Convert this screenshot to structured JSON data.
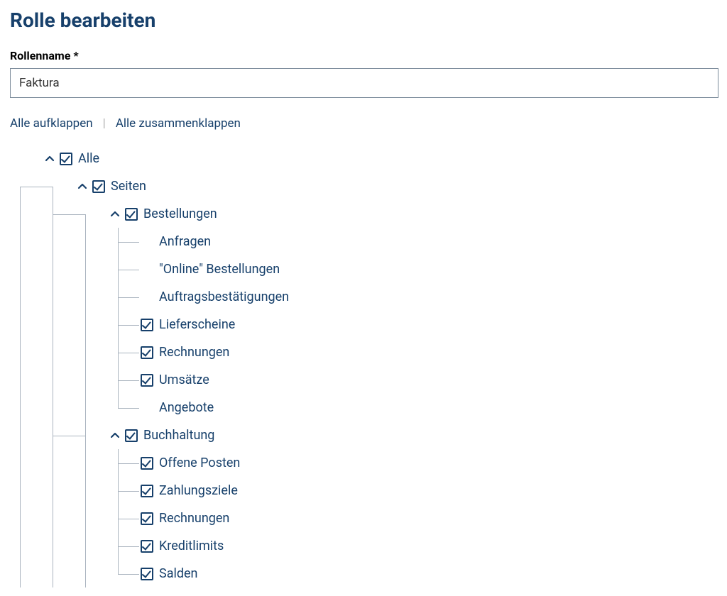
{
  "header": {
    "title": "Rolle bearbeiten"
  },
  "form": {
    "rolename_label": "Rollenname *",
    "rolename_value": "Faktura"
  },
  "actions": {
    "expand_all": "Alle aufklappen",
    "collapse_all": "Alle zusammenklappen",
    "separator": "|"
  },
  "tree": {
    "root": {
      "label": "Alle",
      "checked": true,
      "children": {
        "pages": {
          "label": "Seiten",
          "checked": true,
          "children": {
            "orders": {
              "label": "Bestellungen",
              "checked": true,
              "items": [
                {
                  "label": "Anfragen",
                  "checked": false
                },
                {
                  "label": "\"Online\" Bestellungen",
                  "checked": false
                },
                {
                  "label": "Auftragsbestätigungen",
                  "checked": false
                },
                {
                  "label": "Lieferscheine",
                  "checked": true
                },
                {
                  "label": "Rechnungen",
                  "checked": true
                },
                {
                  "label": "Umsätze",
                  "checked": true
                },
                {
                  "label": "Angebote",
                  "checked": false
                }
              ]
            },
            "accounting": {
              "label": "Buchhaltung",
              "checked": true,
              "items": [
                {
                  "label": "Offene Posten",
                  "checked": true
                },
                {
                  "label": "Zahlungsziele",
                  "checked": true
                },
                {
                  "label": "Rechnungen",
                  "checked": true
                },
                {
                  "label": "Kreditlimits",
                  "checked": true
                },
                {
                  "label": "Salden",
                  "checked": true
                }
              ]
            }
          }
        }
      }
    }
  }
}
